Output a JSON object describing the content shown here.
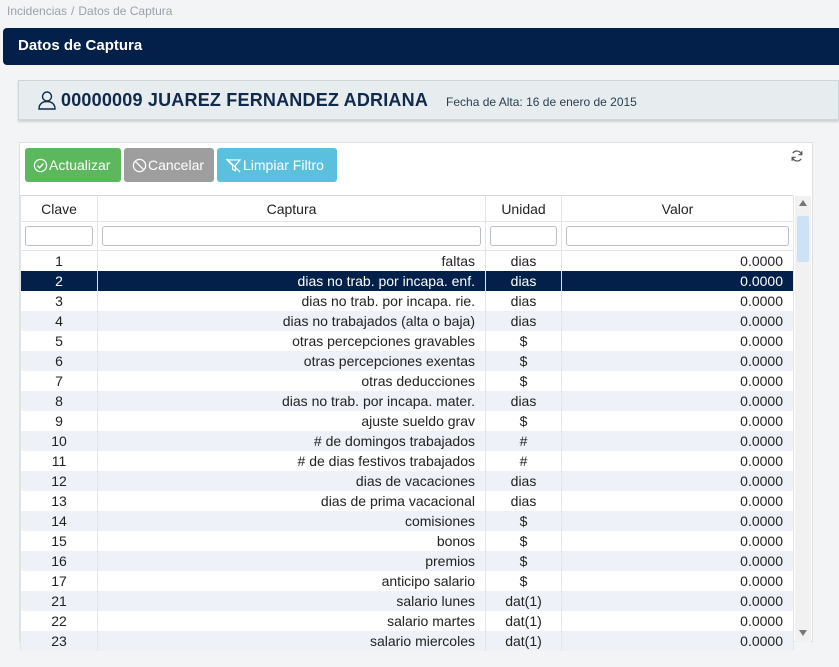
{
  "breadcrumb": {
    "items": [
      "Incidencias",
      "/",
      "Datos de Captura"
    ]
  },
  "title": "Datos de Captura",
  "employee": {
    "name": "00000009 JUAREZ FERNANDEZ ADRIANA",
    "hire_date": "Fecha de Alta: 16 de enero de 2015"
  },
  "toolbar": {
    "update": "Actualizar",
    "cancel": "Cancelar",
    "clear_filter": "Limpiar Filtro"
  },
  "columns": [
    "Clave",
    "Captura",
    "Unidad",
    "Valor"
  ],
  "rows": [
    {
      "clave": "1",
      "captura": "faltas",
      "unidad": "dias",
      "valor": "0.0000"
    },
    {
      "clave": "2",
      "captura": "dias no trab. por incapa. enf.",
      "unidad": "dias",
      "valor": "0.0000"
    },
    {
      "clave": "3",
      "captura": "dias no trab. por incapa. rie.",
      "unidad": "dias",
      "valor": "0.0000"
    },
    {
      "clave": "4",
      "captura": "dias no trabajados (alta o baja)",
      "unidad": "dias",
      "valor": "0.0000"
    },
    {
      "clave": "5",
      "captura": "otras percepciones gravables",
      "unidad": "$",
      "valor": "0.0000"
    },
    {
      "clave": "6",
      "captura": "otras percepciones exentas",
      "unidad": "$",
      "valor": "0.0000"
    },
    {
      "clave": "7",
      "captura": "otras deducciones",
      "unidad": "$",
      "valor": "0.0000"
    },
    {
      "clave": "8",
      "captura": "dias no trab. por incapa. mater.",
      "unidad": "dias",
      "valor": "0.0000"
    },
    {
      "clave": "9",
      "captura": "ajuste sueldo grav",
      "unidad": "$",
      "valor": "0.0000"
    },
    {
      "clave": "10",
      "captura": "# de domingos trabajados",
      "unidad": "#",
      "valor": "0.0000"
    },
    {
      "clave": "11",
      "captura": "# de dias festivos trabajados",
      "unidad": "#",
      "valor": "0.0000"
    },
    {
      "clave": "12",
      "captura": "dias de vacaciones",
      "unidad": "dias",
      "valor": "0.0000"
    },
    {
      "clave": "13",
      "captura": "dias de prima vacacional",
      "unidad": "dias",
      "valor": "0.0000"
    },
    {
      "clave": "14",
      "captura": "comisiones",
      "unidad": "$",
      "valor": "0.0000"
    },
    {
      "clave": "15",
      "captura": "bonos",
      "unidad": "$",
      "valor": "0.0000"
    },
    {
      "clave": "16",
      "captura": "premios",
      "unidad": "$",
      "valor": "0.0000"
    },
    {
      "clave": "17",
      "captura": "anticipo salario",
      "unidad": "$",
      "valor": "0.0000"
    },
    {
      "clave": "21",
      "captura": "salario lunes",
      "unidad": "dat(1)",
      "valor": "0.0000"
    },
    {
      "clave": "22",
      "captura": "salario martes",
      "unidad": "dat(1)",
      "valor": "0.0000"
    },
    {
      "clave": "23",
      "captura": "salario miercoles",
      "unidad": "dat(1)",
      "valor": "0.0000"
    }
  ],
  "selected_clave": "2",
  "colors": {
    "navy": "#03204a",
    "green": "#5cb85c",
    "gray": "#9e9e9e",
    "blue": "#5bc0de",
    "stripe": "#eef1f8"
  }
}
